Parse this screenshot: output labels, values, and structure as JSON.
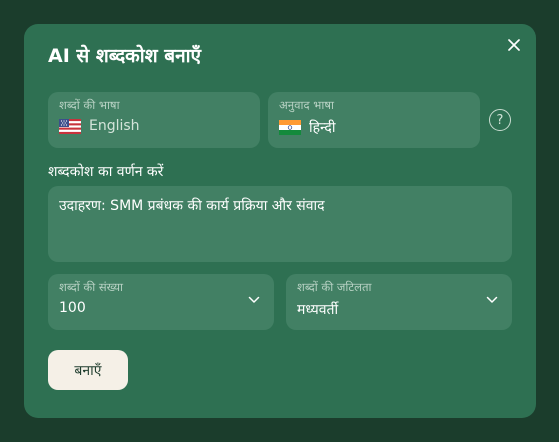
{
  "dialog": {
    "title": "AI से शब्दकोश बनाएँ"
  },
  "source_language": {
    "label": "शब्दों की भाषा",
    "value": "English",
    "flag": "us-flag"
  },
  "translation_language": {
    "label": "अनुवाद भाषा",
    "value": "हिन्दी",
    "flag": "india-flag"
  },
  "help": {
    "symbol": "?"
  },
  "description": {
    "label": "शब्दकोश का वर्णन करें",
    "placeholder": "उदाहरण: SMM प्रबंधक की कार्य प्रक्रिया और संवाद"
  },
  "word_count": {
    "label": "शब्दों की संख्या",
    "value": "100"
  },
  "word_complexity": {
    "label": "शब्दों की जटिलता",
    "value": "मध्यवर्ती"
  },
  "actions": {
    "create_label": "बनाएँ"
  },
  "colors": {
    "backdrop": "#1b3d2c",
    "dialog": "#2e7052",
    "field": "#428064",
    "button": "#f5f0e7"
  }
}
